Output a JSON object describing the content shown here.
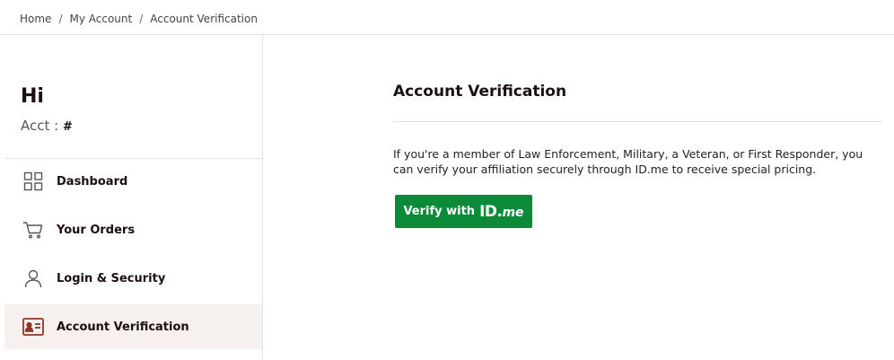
{
  "breadcrumb": {
    "items": [
      "Home",
      "My Account",
      "Account Verification"
    ],
    "separator": "/"
  },
  "sidebar": {
    "greeting": "Hi",
    "acct_label": "Acct :",
    "acct_value": "#",
    "items": [
      {
        "label": "Dashboard",
        "icon": "grid-icon",
        "active": false
      },
      {
        "label": "Your Orders",
        "icon": "cart-icon",
        "active": false
      },
      {
        "label": "Login & Security",
        "icon": "user-icon",
        "active": false
      },
      {
        "label": "Account Verification",
        "icon": "id-card-icon",
        "active": true
      }
    ]
  },
  "main": {
    "title": "Account Verification",
    "description": "If you're a member of Law Enforcement, Military, a Veteran, or First Responder, you can verify your affiliation securely through ID.me to receive special pricing.",
    "button": {
      "prefix": "Verify with",
      "brand_id": "ID.",
      "brand_me": "me"
    }
  },
  "colors": {
    "accent_green": "#0b8a3a",
    "active_bg": "#f6f1ee",
    "icon_brown": "#8a3a2a",
    "text_dark": "#1c0f0f"
  }
}
